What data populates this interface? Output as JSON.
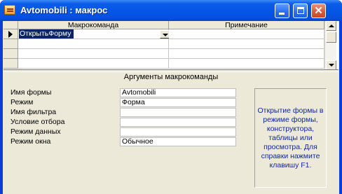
{
  "window": {
    "title": "Avtomobili : макрос"
  },
  "grid": {
    "columns": [
      "Макрокоманда",
      "Примечание"
    ],
    "rows": [
      {
        "action": "ОткрытьФорму",
        "note": ""
      }
    ]
  },
  "arguments": {
    "header": "Аргументы макрокоманды",
    "fields": [
      {
        "label": "Имя формы",
        "value": "Avtomobili"
      },
      {
        "label": "Режим",
        "value": "Форма"
      },
      {
        "label": "Имя фильтра",
        "value": ""
      },
      {
        "label": "Условие отбора",
        "value": ""
      },
      {
        "label": "Режим данных",
        "value": ""
      },
      {
        "label": "Режим окна",
        "value": "Обычное"
      }
    ],
    "help_text": "Открытие формы в режиме формы, конструктора, таблицы или просмотра. Для справки нажмите клавишу F1."
  },
  "colors": {
    "title_bar": "#0556e6",
    "window_bg": "#ece9d8",
    "selection": "#0a246a",
    "help_text": "#10289c"
  }
}
